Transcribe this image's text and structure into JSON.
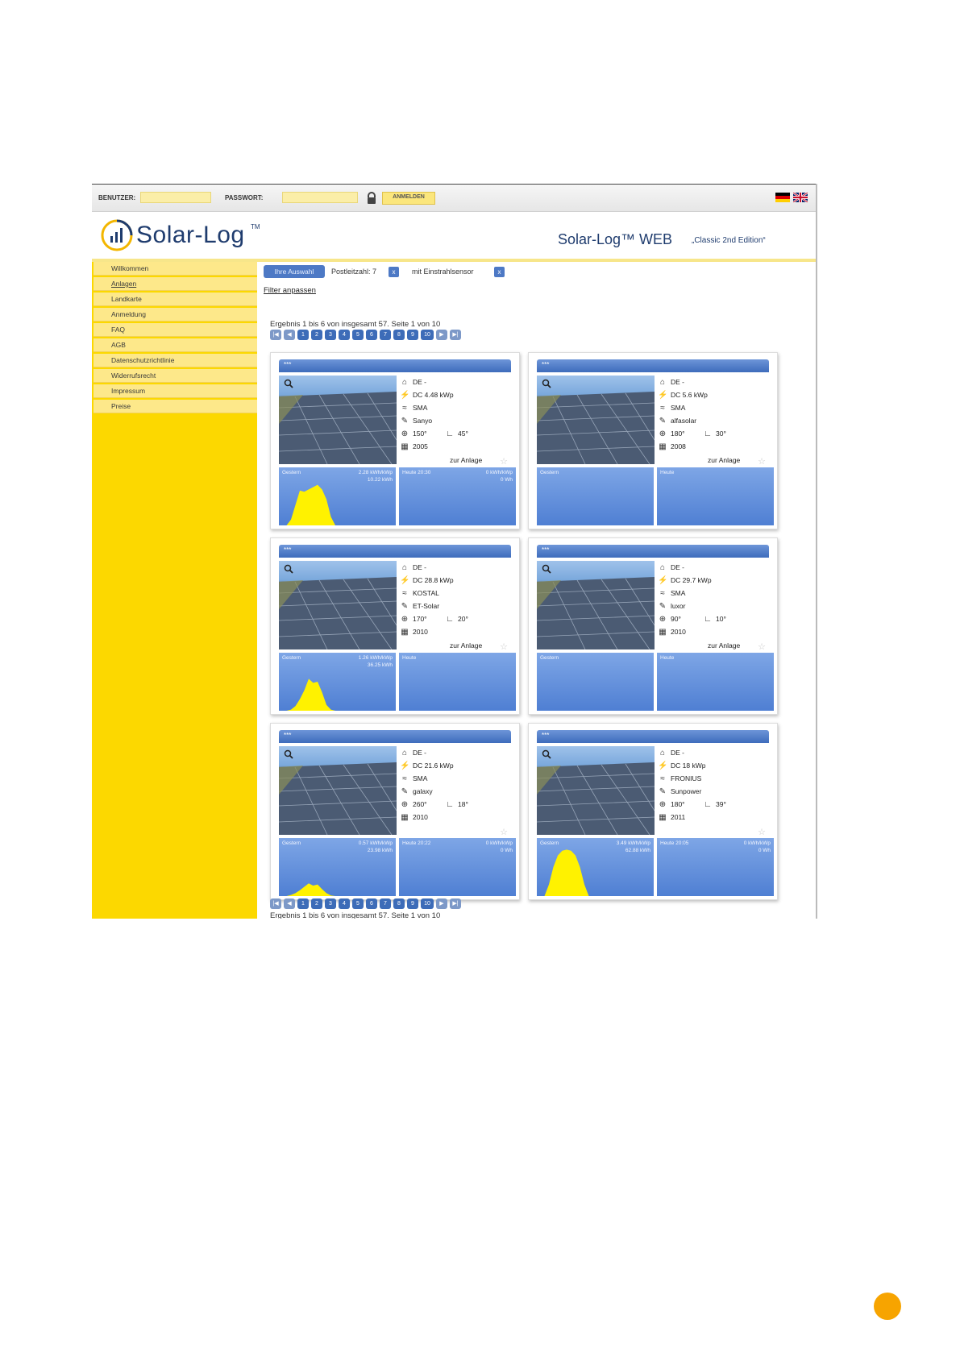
{
  "loginbar": {
    "user_label": "BENUTZER:",
    "user_value": "",
    "password_label": "PASSWORT:",
    "password_value": "",
    "login_button": "ANMELDEN"
  },
  "header": {
    "logo_text": "Solar-Log",
    "logo_tm": "TM",
    "web_title": "Solar-Log™ WEB",
    "web_subtitle": "„Classic 2nd Edition“"
  },
  "nav": {
    "items": [
      "Willkommen",
      "Anlagen",
      "Landkarte",
      "Anmeldung",
      "FAQ",
      "AGB",
      "Datenschutzrichtlinie",
      "Widerrufsrecht",
      "Impressum",
      "Preise"
    ]
  },
  "filter": {
    "selection_chip": "Ihre Auswahl",
    "postcode": "Postleitzahl: 7",
    "sensor": "mit Einstrahlsensor",
    "remove": "x",
    "adjust_link": "Filter anpassen"
  },
  "results": {
    "summary": "Ergebnis 1 bis 6 von insgesamt 57. Seite 1 von 10",
    "pages": [
      "1",
      "2",
      "3",
      "4",
      "5",
      "6",
      "7",
      "8",
      "9",
      "10"
    ],
    "first": "|◀",
    "prev": "◀",
    "next": "▶",
    "last": "▶|"
  },
  "cards": [
    {
      "title": "***",
      "country": "DE -",
      "power": "DC 4.48 kWp",
      "inverter": "SMA",
      "module": "Sanyo",
      "azimuth": "150°",
      "tilt": "45°",
      "year": "2005",
      "link": "zur Anlage",
      "left_label": "Gestern",
      "left_value1": "2.28 kWh/kWp",
      "left_value2": "10.22 kWh",
      "right_label": "Heute 20:30",
      "right_value1": "0 kWh/kWp",
      "right_value2": "0 Wh",
      "yesterday_curve": [
        0,
        0,
        0.1,
        0.35,
        0.6,
        0.58,
        0.62,
        0.66,
        0.7,
        0.62,
        0.45,
        0.15,
        0
      ]
    },
    {
      "title": "***",
      "country": "DE -",
      "power": "DC 5.6 kWp",
      "inverter": "SMA",
      "module": "alfasolar",
      "azimuth": "180°",
      "tilt": "30°",
      "year": "2008",
      "link": "zur Anlage",
      "left_label": "Gestern",
      "left_value1": "",
      "left_value2": "",
      "right_label": "Heute",
      "right_value1": "",
      "right_value2": "",
      "yesterday_curve": []
    },
    {
      "title": "***",
      "country": "DE -",
      "power": "DC 28.8 kWp",
      "inverter": "KOSTAL",
      "module": "ET-Solar",
      "azimuth": "170°",
      "tilt": "20°",
      "year": "2010",
      "link": "zur Anlage",
      "left_label": "Gestern",
      "left_value1": "1.26 kWh/kWp",
      "left_value2": "36.25 kWh",
      "right_label": "Heute",
      "right_value1": "",
      "right_value2": "",
      "yesterday_curve": [
        0,
        0,
        0.02,
        0.08,
        0.2,
        0.35,
        0.55,
        0.48,
        0.5,
        0.32,
        0.1,
        0.02,
        0
      ]
    },
    {
      "title": "***",
      "country": "DE -",
      "power": "DC 29.7 kWp",
      "inverter": "SMA",
      "module": "luxor",
      "azimuth": "90°",
      "tilt": "10°",
      "year": "2010",
      "link": "zur Anlage",
      "left_label": "Gestern",
      "left_value1": "",
      "left_value2": "",
      "right_label": "Heute",
      "right_value1": "",
      "right_value2": "",
      "yesterday_curve": []
    },
    {
      "title": "***",
      "country": "DE -",
      "power": "DC 21.6 kWp",
      "inverter": "SMA",
      "module": "galaxy",
      "azimuth": "260°",
      "tilt": "18°",
      "year": "2010",
      "link": "",
      "left_label": "Gestern",
      "left_value1": "0.57 kWh/kWp",
      "left_value2": "23.98 kWh",
      "right_label": "Heute 20:22",
      "right_value1": "0 kWh/kWp",
      "right_value2": "0 Wh",
      "yesterday_curve": [
        0,
        0,
        0.02,
        0.05,
        0.1,
        0.16,
        0.22,
        0.18,
        0.2,
        0.12,
        0.05,
        0.01,
        0
      ]
    },
    {
      "title": "***",
      "country": "DE -",
      "power": "DC 18 kWp",
      "inverter": "FRONIUS",
      "module": "Sunpower",
      "azimuth": "180°",
      "tilt": "39°",
      "year": "2011",
      "link": "",
      "left_label": "Gestern",
      "left_value1": "3.49 kWh/kWp",
      "left_value2": "62.88 kWh",
      "right_label": "Heute 20:05",
      "right_value1": "0 kWh/kWp",
      "right_value2": "0 Wh",
      "yesterday_curve": [
        0,
        0,
        0.2,
        0.5,
        0.7,
        0.78,
        0.8,
        0.78,
        0.7,
        0.5,
        0.2,
        0,
        0
      ]
    }
  ],
  "colors": {
    "sidebar": "#fcd800",
    "accent_blue": "#3e6cbc",
    "curve_yellow": "#fff200",
    "page_badge": "#f7a400"
  }
}
